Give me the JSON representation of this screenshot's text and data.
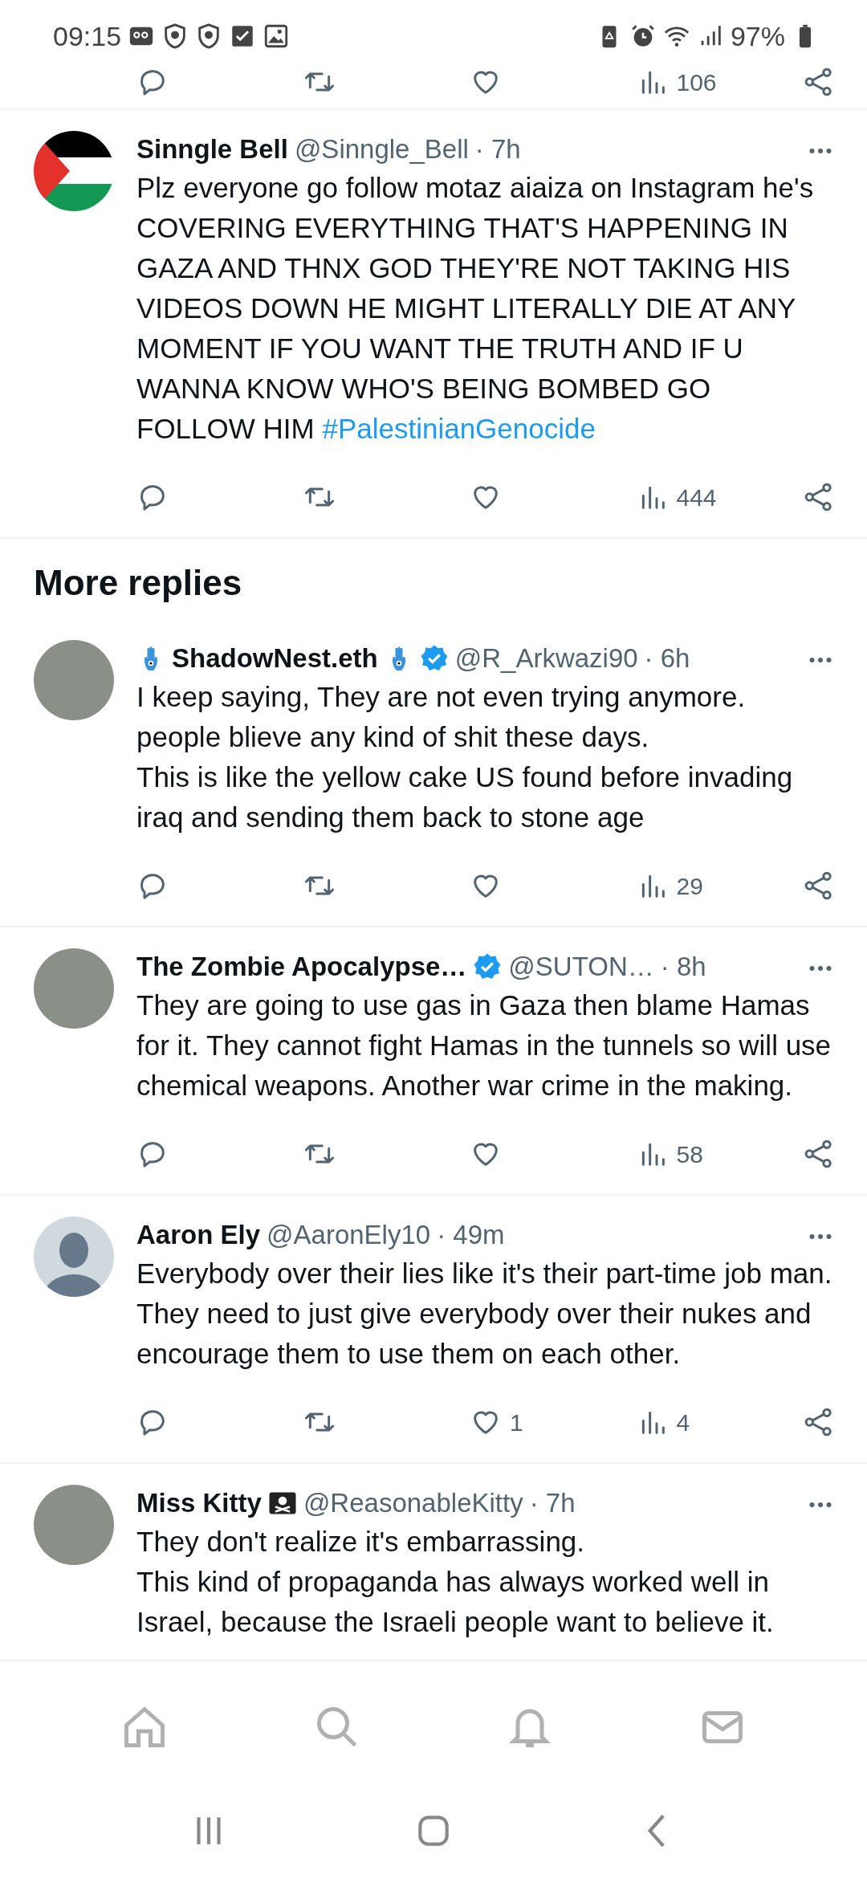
{
  "status_bar": {
    "time": "09:15",
    "battery": "97%"
  },
  "previous_post": {
    "views": "106"
  },
  "posts": [
    {
      "avatar": {
        "kind": "flag"
      },
      "name": "Sinngle Bell",
      "verified": false,
      "handle": "@Sinngle_Bell",
      "time": "· 7h",
      "text": "Plz everyone go follow motaz aiaiza on Instagram he's COVERING EVERYTHING THAT'S HAPPENING IN GAZA AND THNX GOD THEY'RE NOT TAKING HIS VIDEOS DOWN HE MIGHT LITERALLY DIE AT ANY MOMENT IF YOU WANT THE TRUTH AND IF U WANNA KNOW WHO'S BEING BOMBED GO FOLLOW HIM",
      "hashtag": "#PalestinianGenocide",
      "stats": {
        "views": "444"
      }
    }
  ],
  "section_title": "More replies",
  "replies": [
    {
      "avatar": {
        "kind": "photo"
      },
      "icons_before_name": [
        {
          "kind": "hamsa"
        }
      ],
      "name": "ShadowNest.eth",
      "icons_after_name": [
        {
          "kind": "hamsa"
        }
      ],
      "verified": true,
      "handle": "@R_Arkwazi90",
      "time": "· 6h",
      "text": "I keep saying, They are not even trying anymore.\npeople blieve any kind of shit these days.\nThis is like the yellow cake US found before invading iraq and sending them back to stone age",
      "stats": {
        "views": "29"
      }
    },
    {
      "avatar": {
        "kind": "photo"
      },
      "name": "The Zombie Apocalypse…",
      "verified": true,
      "handle": "@SUTON…",
      "time": "· 8h",
      "text": "They are going to use gas in Gaza then blame Hamas for it. They cannot fight Hamas in the tunnels so will use chemical weapons. Another war crime in the making.",
      "stats": {
        "views": "58"
      }
    },
    {
      "avatar": {
        "kind": "default"
      },
      "name": "Aaron Ely",
      "verified": false,
      "handle": "@AaronEly10",
      "time": "· 49m",
      "text": "Everybody over their lies like it's their part-time job man. They need to just give everybody over their nukes and encourage them to use them on each other.",
      "stats": {
        "likes": "1",
        "views": "4"
      }
    },
    {
      "avatar": {
        "kind": "photo"
      },
      "name": "Miss Kitty",
      "icons_after_name": [
        {
          "kind": "pirate_flag"
        }
      ],
      "verified": false,
      "handle": "@ReasonableKitty",
      "time": "· 7h",
      "text": "They don't realize it's embarrassing.\nThis kind of propaganda has always worked well in Israel, because the Israeli people want to believe it."
    }
  ]
}
